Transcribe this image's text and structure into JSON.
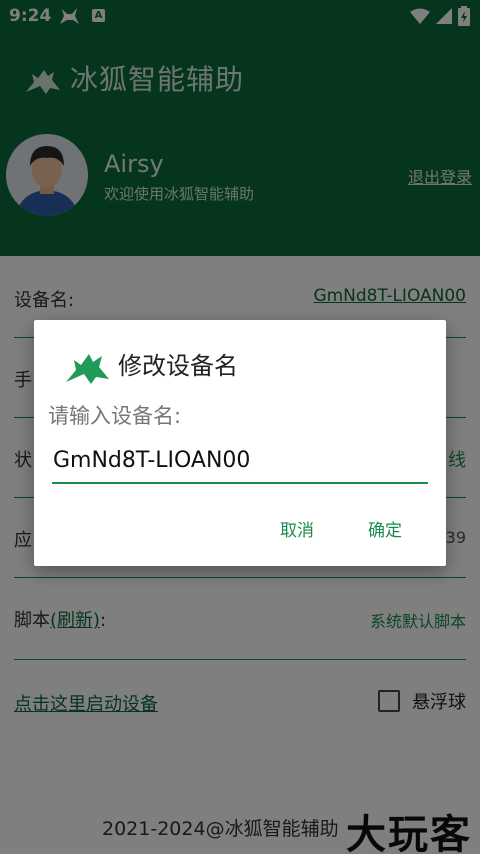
{
  "status_bar": {
    "time": "9:24",
    "a_badge": "A"
  },
  "header": {
    "app_title": "冰狐智能辅助",
    "user_name": "Airsy",
    "welcome": "欢迎使用冰狐智能辅助",
    "logout": "退出登录"
  },
  "rows": {
    "device_name_label": "设备名:",
    "device_name_value": "GmNd8T-LIOAN00",
    "phone_label": "手",
    "status_label": "状",
    "status_value": "线",
    "app_label": "应",
    "app_value": "39",
    "script_label_prefix": "脚本",
    "script_refresh": "(刷新)",
    "script_label_suffix": ":",
    "script_value": "系统默认脚本"
  },
  "actions": {
    "start_device": "点击这里启动设备",
    "float_ball": "悬浮球",
    "float_ball_checked": false
  },
  "footer": {
    "copyright": "2021-2024@冰狐智能辅助",
    "watermark": "大玩客"
  },
  "dialog": {
    "title": "修改设备名",
    "prompt": "请输入设备名:",
    "input_value": "GmNd8T-LIOAN00",
    "cancel": "取消",
    "confirm": "确定"
  },
  "colors": {
    "brand_green": "#0d6b3a",
    "accent_green": "#1a8a4f"
  }
}
